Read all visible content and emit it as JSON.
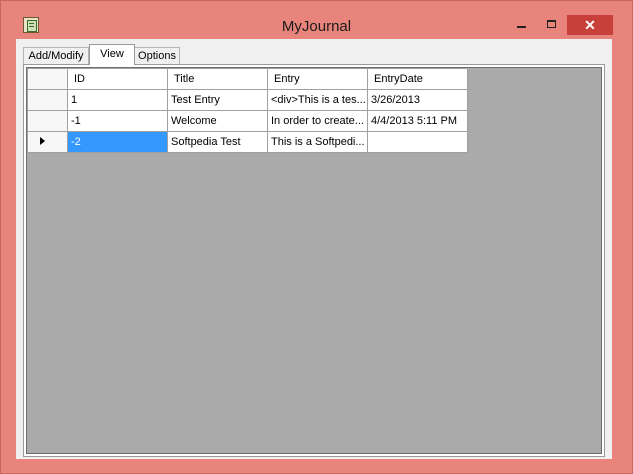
{
  "window": {
    "title": "MyJournal"
  },
  "controls": {
    "close": "✕"
  },
  "tabs": [
    {
      "label": "Add/Modify"
    },
    {
      "label": "View"
    },
    {
      "label": "Options"
    }
  ],
  "grid": {
    "columns": [
      "ID",
      "Title",
      "Entry",
      "EntryDate"
    ],
    "rows": [
      {
        "id": "1",
        "title": "Test Entry",
        "entry": "<div>This is a tes...",
        "date": "3/26/2013"
      },
      {
        "id": "-1",
        "title": "Welcome",
        "entry": "In order to create...",
        "date": "4/4/2013 5:11 PM"
      },
      {
        "id": "-2",
        "title": "Softpedia Test",
        "entry": "This is a Softpedi...",
        "date": ""
      }
    ]
  },
  "colors": {
    "frame": "#e8847b",
    "close": "#c7403a",
    "selection": "#3399ff",
    "grid_bg": "#aaaaaa"
  }
}
